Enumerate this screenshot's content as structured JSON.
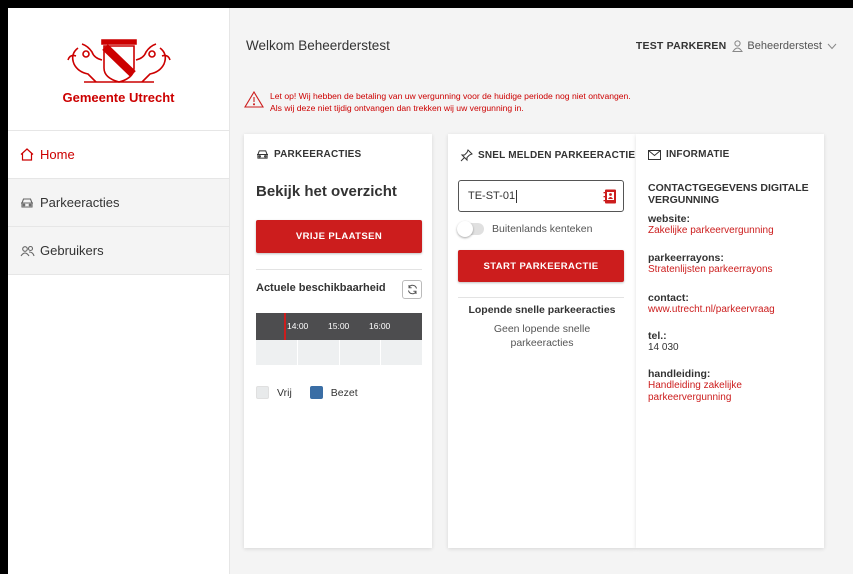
{
  "sidebar": {
    "logo_text": "Gemeente Utrecht",
    "items": [
      {
        "label": "Home",
        "icon": "home-icon",
        "active": true
      },
      {
        "label": "Parkeeracties",
        "icon": "car-icon",
        "active": false
      },
      {
        "label": "Gebruikers",
        "icon": "users-icon",
        "active": false
      }
    ]
  },
  "header": {
    "welcome": "Welkom Beheerderstest",
    "org": "TEST PARKEREN",
    "user": "Beheerderstest"
  },
  "warning": {
    "line1": "Let op! Wij hebben de betaling van uw vergunning voor de huidige periode nog niet ontvangen.",
    "line2": "Als wij deze niet tijdig ontvangen dan trekken wij uw vergunning in."
  },
  "parkeeracties": {
    "title": "PARKEERACTIES",
    "heading": "Bekijk het overzicht",
    "button": "VRIJE PLAATSEN",
    "availability_title": "Actuele beschikbaarheid",
    "timeline": [
      "14:00",
      "15:00",
      "16:00"
    ],
    "legend": {
      "free": "Vrij",
      "occupied": "Bezet"
    },
    "colors": {
      "occupied": "#3a6ea5",
      "free": "#e8eaeb",
      "now": "#cc1d1d"
    }
  },
  "snel": {
    "title": "SNEL MELDEN PARKEERACTIE",
    "plate_value": "TE-ST-01",
    "foreign_label": "Buitenlands kenteken",
    "foreign_on": false,
    "button": "START PARKEERACTIE",
    "running_title": "Lopende snelle parkeeracties",
    "running_empty": "Geen lopende snelle parkeeracties"
  },
  "informatie": {
    "title": "INFORMATIE",
    "section_title": "CONTACTGEGEVENS DIGITALE VERGUNNING",
    "website_label": "website:",
    "website_link": "Zakelijke parkeervergunning",
    "rayons_label": "parkeerrayons:",
    "rayons_link": "Stratenlijsten parkeerrayons",
    "contact_label": "contact:",
    "contact_link": "www.utrecht.nl/parkeervraag",
    "tel_label": "tel.:",
    "tel_value": "14 030",
    "handleiding_label": "handleiding:",
    "handleiding_link": "Handleiding zakelijke parkeervergunning"
  },
  "brand": {
    "red": "#cc1d1d",
    "dark": "#4d4d4f"
  }
}
